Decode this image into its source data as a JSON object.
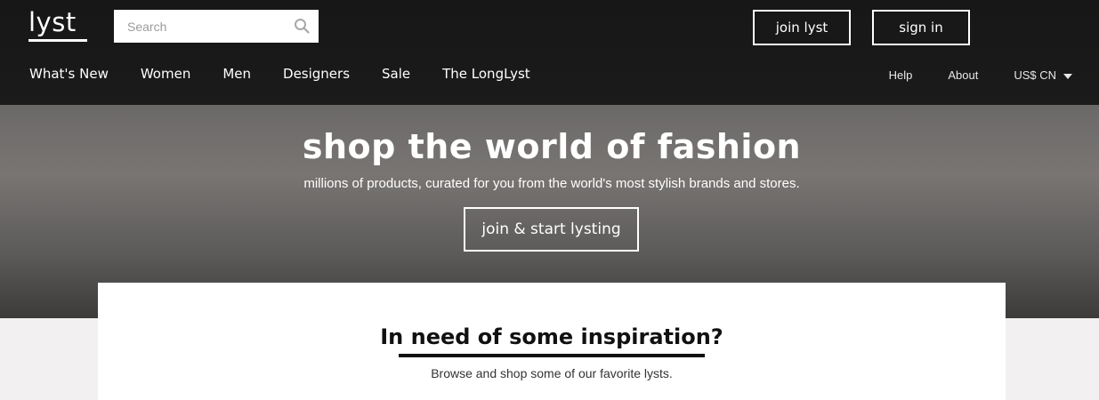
{
  "header": {
    "logo": "lyst",
    "search": {
      "placeholder": "Search"
    },
    "join_label": "join lyst",
    "signin_label": "sign in"
  },
  "nav": {
    "main": [
      "What's New",
      "Women",
      "Men",
      "Designers",
      "Sale",
      "The LongLyst"
    ],
    "right": {
      "help": "Help",
      "about": "About",
      "currency": "US$ CN"
    }
  },
  "hero": {
    "title": "shop the world of fashion",
    "subtitle": "millions of products, curated for you from the world's most stylish brands and stores.",
    "cta": "join & start lysting"
  },
  "inspiration": {
    "title": "In need of some inspiration?",
    "subtitle": "Browse and shop some of our favorite lysts."
  },
  "colors": {
    "nav_background": "#0a0a0a",
    "text_light": "#ffffff",
    "page_background": "#f2f0f1"
  },
  "icons": {
    "search": "search-icon",
    "currency_dropdown": "chevron-down-icon"
  }
}
